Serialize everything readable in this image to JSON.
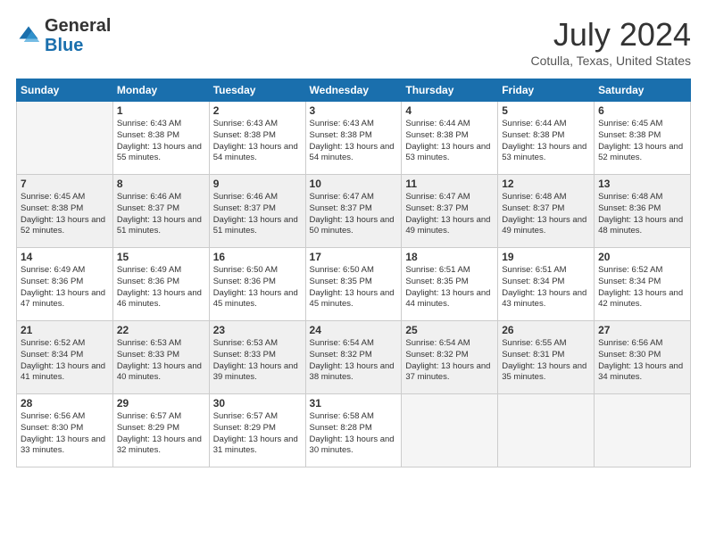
{
  "logo": {
    "general": "General",
    "blue": "Blue"
  },
  "header": {
    "title": "July 2024",
    "location": "Cotulla, Texas, United States"
  },
  "days_of_week": [
    "Sunday",
    "Monday",
    "Tuesday",
    "Wednesday",
    "Thursday",
    "Friday",
    "Saturday"
  ],
  "weeks": [
    [
      {
        "day": "",
        "empty": true
      },
      {
        "day": "1",
        "sunrise": "6:43 AM",
        "sunset": "8:38 PM",
        "daylight": "13 hours and 55 minutes."
      },
      {
        "day": "2",
        "sunrise": "6:43 AM",
        "sunset": "8:38 PM",
        "daylight": "13 hours and 54 minutes."
      },
      {
        "day": "3",
        "sunrise": "6:43 AM",
        "sunset": "8:38 PM",
        "daylight": "13 hours and 54 minutes."
      },
      {
        "day": "4",
        "sunrise": "6:44 AM",
        "sunset": "8:38 PM",
        "daylight": "13 hours and 53 minutes."
      },
      {
        "day": "5",
        "sunrise": "6:44 AM",
        "sunset": "8:38 PM",
        "daylight": "13 hours and 53 minutes."
      },
      {
        "day": "6",
        "sunrise": "6:45 AM",
        "sunset": "8:38 PM",
        "daylight": "13 hours and 52 minutes."
      }
    ],
    [
      {
        "day": "7",
        "sunrise": "6:45 AM",
        "sunset": "8:38 PM",
        "daylight": "13 hours and 52 minutes."
      },
      {
        "day": "8",
        "sunrise": "6:46 AM",
        "sunset": "8:37 PM",
        "daylight": "13 hours and 51 minutes."
      },
      {
        "day": "9",
        "sunrise": "6:46 AM",
        "sunset": "8:37 PM",
        "daylight": "13 hours and 51 minutes."
      },
      {
        "day": "10",
        "sunrise": "6:47 AM",
        "sunset": "8:37 PM",
        "daylight": "13 hours and 50 minutes."
      },
      {
        "day": "11",
        "sunrise": "6:47 AM",
        "sunset": "8:37 PM",
        "daylight": "13 hours and 49 minutes."
      },
      {
        "day": "12",
        "sunrise": "6:48 AM",
        "sunset": "8:37 PM",
        "daylight": "13 hours and 49 minutes."
      },
      {
        "day": "13",
        "sunrise": "6:48 AM",
        "sunset": "8:36 PM",
        "daylight": "13 hours and 48 minutes."
      }
    ],
    [
      {
        "day": "14",
        "sunrise": "6:49 AM",
        "sunset": "8:36 PM",
        "daylight": "13 hours and 47 minutes."
      },
      {
        "day": "15",
        "sunrise": "6:49 AM",
        "sunset": "8:36 PM",
        "daylight": "13 hours and 46 minutes."
      },
      {
        "day": "16",
        "sunrise": "6:50 AM",
        "sunset": "8:36 PM",
        "daylight": "13 hours and 45 minutes."
      },
      {
        "day": "17",
        "sunrise": "6:50 AM",
        "sunset": "8:35 PM",
        "daylight": "13 hours and 45 minutes."
      },
      {
        "day": "18",
        "sunrise": "6:51 AM",
        "sunset": "8:35 PM",
        "daylight": "13 hours and 44 minutes."
      },
      {
        "day": "19",
        "sunrise": "6:51 AM",
        "sunset": "8:34 PM",
        "daylight": "13 hours and 43 minutes."
      },
      {
        "day": "20",
        "sunrise": "6:52 AM",
        "sunset": "8:34 PM",
        "daylight": "13 hours and 42 minutes."
      }
    ],
    [
      {
        "day": "21",
        "sunrise": "6:52 AM",
        "sunset": "8:34 PM",
        "daylight": "13 hours and 41 minutes."
      },
      {
        "day": "22",
        "sunrise": "6:53 AM",
        "sunset": "8:33 PM",
        "daylight": "13 hours and 40 minutes."
      },
      {
        "day": "23",
        "sunrise": "6:53 AM",
        "sunset": "8:33 PM",
        "daylight": "13 hours and 39 minutes."
      },
      {
        "day": "24",
        "sunrise": "6:54 AM",
        "sunset": "8:32 PM",
        "daylight": "13 hours and 38 minutes."
      },
      {
        "day": "25",
        "sunrise": "6:54 AM",
        "sunset": "8:32 PM",
        "daylight": "13 hours and 37 minutes."
      },
      {
        "day": "26",
        "sunrise": "6:55 AM",
        "sunset": "8:31 PM",
        "daylight": "13 hours and 35 minutes."
      },
      {
        "day": "27",
        "sunrise": "6:56 AM",
        "sunset": "8:30 PM",
        "daylight": "13 hours and 34 minutes."
      }
    ],
    [
      {
        "day": "28",
        "sunrise": "6:56 AM",
        "sunset": "8:30 PM",
        "daylight": "13 hours and 33 minutes."
      },
      {
        "day": "29",
        "sunrise": "6:57 AM",
        "sunset": "8:29 PM",
        "daylight": "13 hours and 32 minutes."
      },
      {
        "day": "30",
        "sunrise": "6:57 AM",
        "sunset": "8:29 PM",
        "daylight": "13 hours and 31 minutes."
      },
      {
        "day": "31",
        "sunrise": "6:58 AM",
        "sunset": "8:28 PM",
        "daylight": "13 hours and 30 minutes."
      },
      {
        "day": "",
        "empty": true
      },
      {
        "day": "",
        "empty": true
      },
      {
        "day": "",
        "empty": true
      }
    ]
  ]
}
